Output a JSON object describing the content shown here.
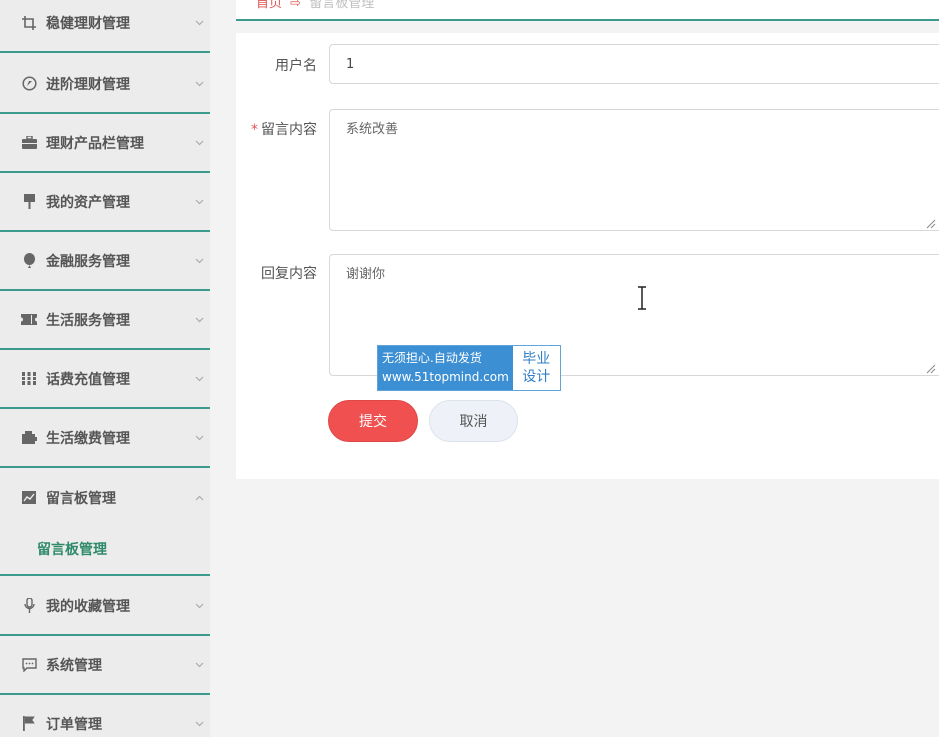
{
  "sidebar": {
    "items": [
      {
        "label": "稳健理财管理",
        "icon": "crop-icon"
      },
      {
        "label": "进阶理财管理",
        "icon": "compass-icon"
      },
      {
        "label": "理财产品栏管理",
        "icon": "briefcase-icon"
      },
      {
        "label": "我的资产管理",
        "icon": "flag-icon"
      },
      {
        "label": "金融服务管理",
        "icon": "balloon-icon"
      },
      {
        "label": "生活服务管理",
        "icon": "ticket-icon"
      },
      {
        "label": "话费充值管理",
        "icon": "grid-icon"
      },
      {
        "label": "生活缴费管理",
        "icon": "wallet-icon"
      },
      {
        "label": "留言板管理",
        "icon": "chart-icon"
      },
      {
        "label": "我的收藏管理",
        "icon": "microphone-icon"
      },
      {
        "label": "系统管理",
        "icon": "message-icon"
      },
      {
        "label": "订单管理",
        "icon": "flag-icon"
      }
    ],
    "subitem": {
      "label": "留言板管理"
    }
  },
  "breadcrumb": {
    "home": "首页",
    "current": "留言板管理"
  },
  "form": {
    "username_label": "用户名",
    "username_value": "1",
    "content_required": "*",
    "content_label": "留言内容",
    "content_value": "系统改善",
    "reply_label": "回复内容",
    "reply_value": "谢谢你",
    "submit_label": "提交",
    "cancel_label": "取消"
  },
  "watermark": {
    "line1": "无须担心.自动发货",
    "line2": "www.51topmind.com",
    "right1": "毕业",
    "right2": "设计"
  },
  "colors": {
    "accent": "#3a9a8c",
    "submit": "#f05050",
    "cancel": "#eef2f8"
  }
}
